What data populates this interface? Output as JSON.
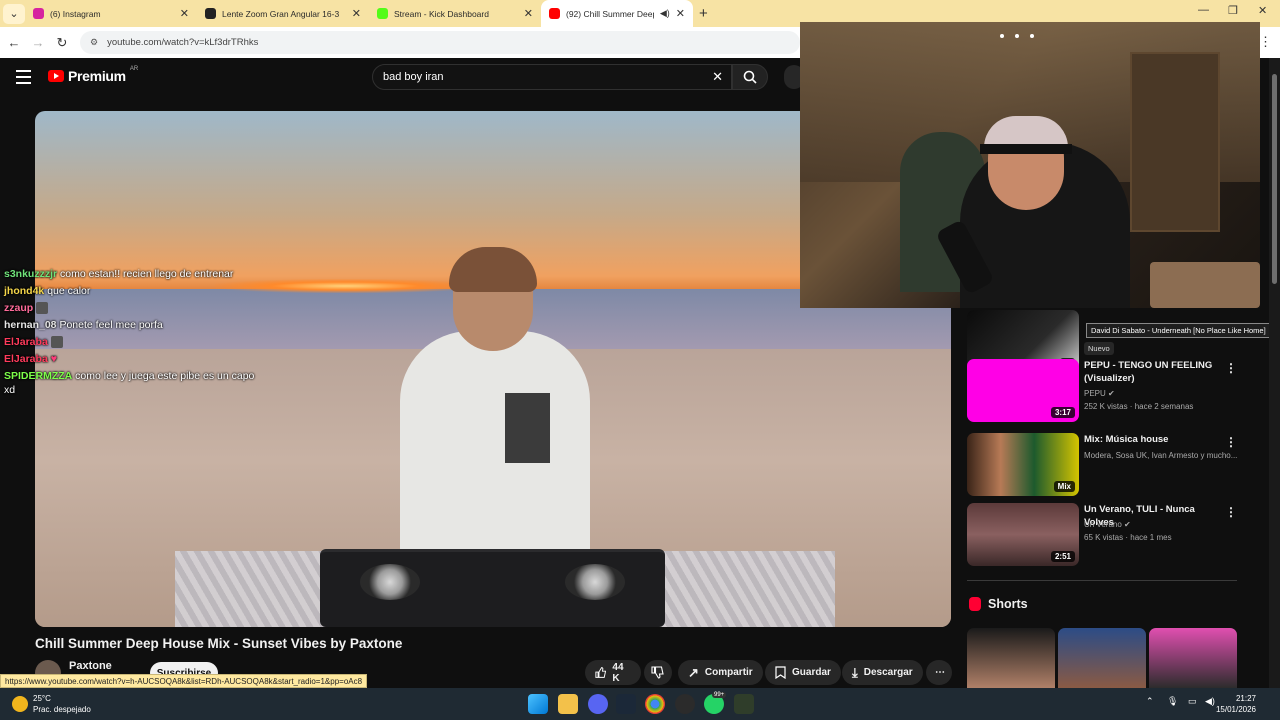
{
  "browser": {
    "tabs": [
      {
        "title": "(6) Instagram",
        "favicon_color": "#d6249f"
      },
      {
        "title": "Lente Zoom Gran Angular 16-3",
        "favicon_color": "#222222"
      },
      {
        "title": "Stream - Kick Dashboard",
        "favicon_color": "#53fc18"
      },
      {
        "title": "(92) Chill Summer Deep Ho",
        "favicon_color": "#ff0000"
      }
    ],
    "url": "youtube.com/watch?v=kLf3drTRhks",
    "status_url": "https://www.youtube.com/watch?v=h-AUCSOQA8k&list=RDh-AUCSOQA8k&start_radio=1&pp=oAc8"
  },
  "youtube": {
    "logo_text": "Premium",
    "logo_region": "AR",
    "search_query": "bad boy iran"
  },
  "video": {
    "title": "Chill Summer Deep House Mix - Sunset Vibes by Paxtone",
    "channel": "Paxtone",
    "subscribe_label": "Suscribirse",
    "likes": "44 K",
    "share_label": "Compartir",
    "save_label": "Guardar",
    "download_label": "Descargar"
  },
  "chat": [
    {
      "user": "s3nkuzzzjr",
      "color": "#6fe27a",
      "message": "como estan!! recien llego de entrenar"
    },
    {
      "user": "jhond4k",
      "color": "#f5d64a",
      "message": "que calor"
    },
    {
      "user": "zzaup",
      "color": "#ff6b9a",
      "message": ""
    },
    {
      "user": "hernan_08",
      "color": "#e6e6e6",
      "message": "Ponete feel mee porfa"
    },
    {
      "user": "ElJaraba",
      "color": "#ff3b5c",
      "message": ""
    },
    {
      "user": "ElJaraba",
      "color": "#ff3b5c",
      "message": ""
    },
    {
      "user": "SPIDERMZZA",
      "color": "#7dff4a",
      "message": "como lee y juega este pibe es un capo"
    },
    {
      "user": "",
      "color": "#ffffff",
      "message": "xd"
    }
  ],
  "sidebar": {
    "tooltip": "David Di Sabato - Underneath [No Place Like Home]",
    "first_item": {
      "title": "(No Place Like Home)",
      "channel": "David Di Sabato",
      "new_label": "Nuevo"
    },
    "items": [
      {
        "title": "PEPU - TENGO UN FEELING (Visualizer)",
        "channel": "PEPU",
        "meta": "252 K vistas · hace 2 semanas",
        "badge": "3:17",
        "thumb": "#ff00e6"
      },
      {
        "title": "Mix: Música house",
        "channel": "Modera, Sosa UK, Ivan Armesto y mucho...",
        "meta": "",
        "badge": "Mix",
        "thumb": "#2b1f1a"
      },
      {
        "title": "Un Verano, TULI - Nunca Volves",
        "channel": "Un Verano",
        "meta": "65 K vistas · hace 1 mes",
        "badge": "2:51",
        "thumb": "#6b3b3b"
      }
    ],
    "shorts_label": "Shorts"
  },
  "taskbar": {
    "temperature": "25°C",
    "weather": "Prac. despejado",
    "time": "21:27",
    "date": "15/01/2026",
    "badge": "99+"
  }
}
